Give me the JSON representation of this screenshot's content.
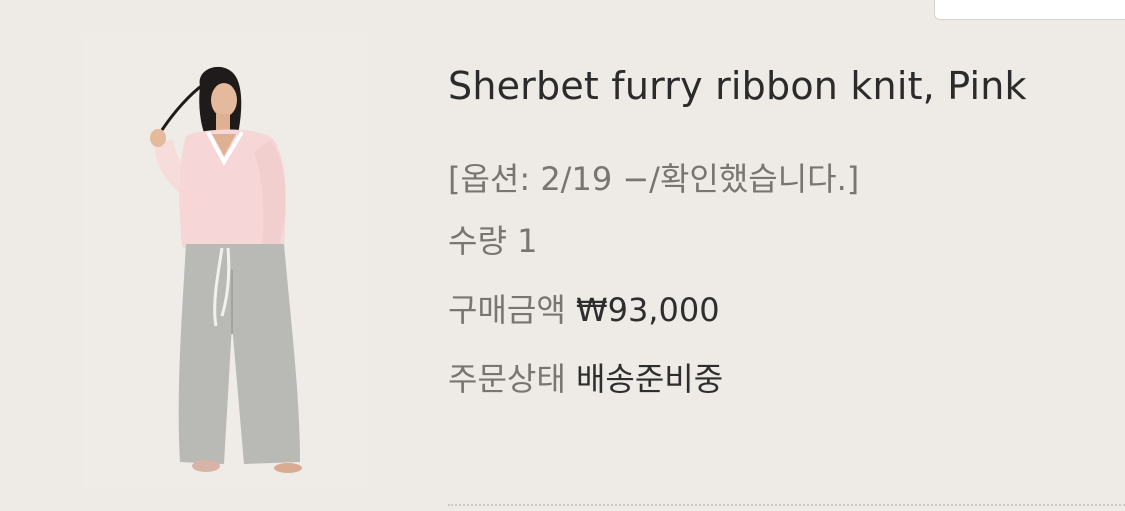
{
  "product": {
    "name": "Sherbet furry ribbon knit, Pink",
    "image_alt": "Model wearing pink furry knit and grey wide sweatpants"
  },
  "order": {
    "options": "[옵션: 2/19 −/확인했습니다.]",
    "quantity_label": "수량",
    "quantity_value": "1",
    "price_label": "구매금액",
    "price_value": "₩93,000",
    "status_label": "주문상태",
    "status_value": "배송준비중"
  },
  "colors": {
    "background": "#eeeae5",
    "title_text": "#2b2b2b",
    "muted_text": "#797570",
    "knit_pink": "#f6d6d6",
    "pants_grey": "#b9b9b6"
  },
  "icons": {
    "product_thumbnail": "product-photo"
  }
}
